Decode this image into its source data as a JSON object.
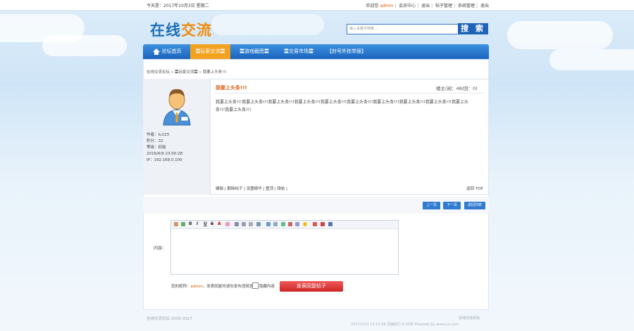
{
  "topbar": {
    "date": "今天是：2017年10月3日 星期二",
    "welcome_prefix": "欢迎您",
    "username": "admin",
    "links": [
      "会员中心",
      "退出",
      "帖子管理",
      "系统管理",
      "退出"
    ]
  },
  "logo": {
    "part1": "在线",
    "part2": "交流"
  },
  "search": {
    "placeholder": "输入关键字搜索…",
    "button": "搜 索"
  },
  "nav": {
    "items": [
      "论坛首页",
      "〓玩家交流〓",
      "〓游戏截图〓",
      "〓交易市场〓",
      "【封号外挂举报】"
    ]
  },
  "breadcrumb": "在线交流论坛 » 〓玩家交流〓 » 我要上头条!!!",
  "post": {
    "title": "我要上头条!!!",
    "stats": "楼主(阅：48/回：0)",
    "body": "我要上头条!!!我要上头条!!!我要上头条!!!我要上头条!!!我要上头条!!!我要上头条!!!我要上头条!!!我要上头条!!!我要上头条!!!我要上头条!!!我要上头条!!!",
    "actions": "编辑 | 删除帖子 | 设置精华 | 置顶 | 锁帖 |",
    "top_link": "返回 TOP"
  },
  "author": {
    "name": "作者：lu123",
    "posts": "积分：32",
    "level": "等级：初级",
    "time": "2016/6/9 23:00:28",
    "ip": "IP：192.168.0.100"
  },
  "pager": {
    "prev": "上一页",
    "next": "下一页",
    "back": "返回列表"
  },
  "editor": {
    "label": "内容：",
    "reply_text_prefix": "您的昵称：",
    "reply_user": "admin",
    "reply_text_suffix": "，发表回复时请勿发布违规言论",
    "checkbox_label": "隐藏内容",
    "submit": "发表回复帖子"
  },
  "footer": {
    "left": "在线交流论坛 2016-2017",
    "right1": "在线交流论坛",
    "right2": "2017/10/3 13:10:26 页面执行 0.03秒 Powered by www.uu.com"
  }
}
